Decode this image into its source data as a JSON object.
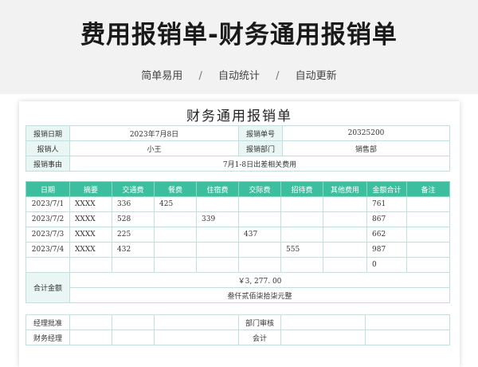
{
  "header": {
    "title": "费用报销单-财务通用报销单",
    "features": [
      "简单易用",
      "自动统计",
      "自动更新"
    ],
    "separator": "/"
  },
  "form": {
    "title": "财务通用报销单",
    "date_label": "报销日期",
    "date_value": "2023年7月8日",
    "number_label": "报销单号",
    "number_value": "20325200",
    "person_label": "报销人",
    "person_value": "小王",
    "dept_label": "报销部门",
    "dept_value": "销售部",
    "reason_label": "报销事由",
    "reason_value": "7月1-8日出差相关费用"
  },
  "table": {
    "columns": [
      "日期",
      "摘要",
      "交通费",
      "餐费",
      "住宿费",
      "交际费",
      "招待费",
      "其他费用",
      "金额合计",
      "备注"
    ],
    "rows": [
      [
        "2023/7/1",
        "XXXX",
        "336",
        "425",
        "",
        "",
        "",
        "",
        "761",
        ""
      ],
      [
        "2023/7/2",
        "XXXX",
        "528",
        "",
        "339",
        "",
        "",
        "",
        "867",
        ""
      ],
      [
        "2023/7/3",
        "XXXX",
        "225",
        "",
        "",
        "437",
        "",
        "",
        "662",
        ""
      ],
      [
        "2023/7/4",
        "XXXX",
        "432",
        "",
        "",
        "",
        "555",
        "",
        "987",
        ""
      ],
      [
        "",
        "",
        "",
        "",
        "",
        "",
        "",
        "",
        "0",
        ""
      ]
    ],
    "total_label": "合计金额",
    "total_numeric": "￥3, 277. 00",
    "total_chinese": "叁仟贰佰柒拾柒元整"
  },
  "approvals": {
    "manager_label": "经理批准",
    "dept_review_label": "部门审核",
    "finance_manager_label": "财务经理",
    "accounting_label": "会计"
  },
  "colors": {
    "header_bg": "#3cbf9f",
    "label_bg": "#e9f6f4",
    "border": "#bfe0df"
  }
}
